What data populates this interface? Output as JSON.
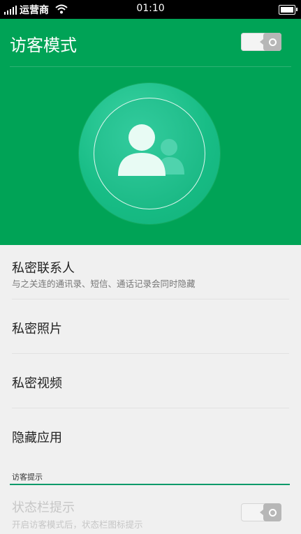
{
  "status_bar": {
    "carrier": "运营商",
    "time": "01:10"
  },
  "header": {
    "title": "访客模式",
    "toggle_on": false
  },
  "colors": {
    "header_green": "#00a356",
    "accent_line": "#0a9a6a",
    "background": "#f0f0f0"
  },
  "hero_icon": "guest-users-icon",
  "items": [
    {
      "title": "私密联系人",
      "subtitle": "与之关连的通讯录、短信、通话记录会同时隐藏"
    },
    {
      "title": "私密照片"
    },
    {
      "title": "私密视频"
    },
    {
      "title": "隐藏应用"
    }
  ],
  "section": {
    "label": "访客提示"
  },
  "status_hint": {
    "title": "状态栏提示",
    "subtitle": "开启访客模式后，状态栏图标提示",
    "toggle_on": false
  }
}
